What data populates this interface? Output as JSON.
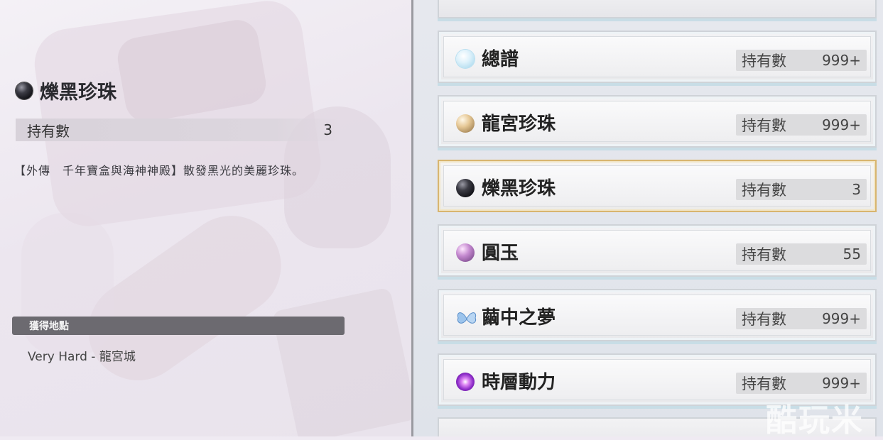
{
  "detail": {
    "title": "爍黑珍珠",
    "owned_label": "持有數",
    "owned_value": "3",
    "description": "【外傳　千年寶盒與海神神殿】散發黑光的美麗珍珠。",
    "location_header": "獲得地點",
    "location_value": "Very Hard - 龍宮城"
  },
  "list": {
    "items": [
      {
        "name": "總譜",
        "icon": "ice-orb-icon",
        "qty_label": "持有數",
        "qty": "999+"
      },
      {
        "name": "龍宮珍珠",
        "icon": "gold-pearl-icon",
        "qty_label": "持有數",
        "qty": "999+"
      },
      {
        "name": "爍黑珍珠",
        "icon": "black-pearl-icon",
        "qty_label": "持有數",
        "qty": "3",
        "selected": true
      },
      {
        "name": "圓玉",
        "icon": "purple-orb-icon",
        "qty_label": "持有數",
        "qty": "55"
      },
      {
        "name": "繭中之夢",
        "icon": "butterfly-icon",
        "qty_label": "持有數",
        "qty": "999+"
      },
      {
        "name": "時層動力",
        "icon": "swirl-orb-icon",
        "qty_label": "持有數",
        "qty": "999+"
      }
    ]
  },
  "watermark": "酷玩米"
}
